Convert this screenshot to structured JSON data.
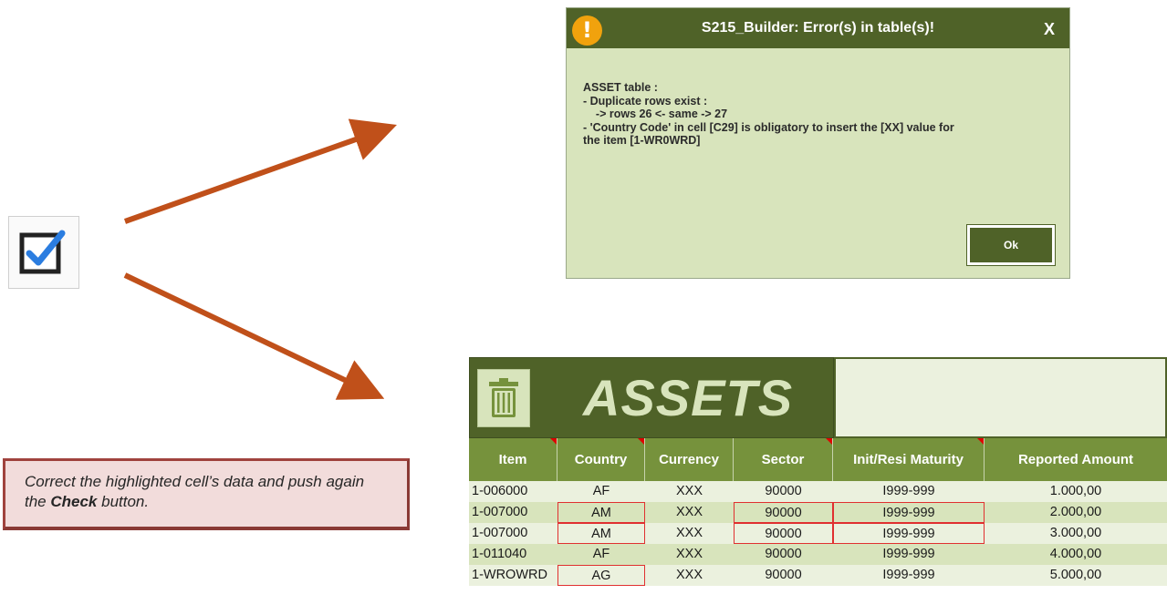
{
  "dialog": {
    "title": "S215_Builder: Error(s) in table(s)!",
    "close_label": "X",
    "warning_symbol": "!",
    "lines": [
      "ASSET table :",
      "- Duplicate rows exist :",
      "    -> rows 26 <- same -> 27",
      "- 'Country Code' in cell [C29] is obligatory to insert the [XX] value for",
      "the item [1-WR0WRD]"
    ],
    "ok_label": "Ok"
  },
  "note": {
    "text_before": "Correct the highlighted cell’s data and push again the ",
    "text_bold": "Check",
    "text_after": " button."
  },
  "sheet": {
    "title": "ASSETS",
    "columns": [
      "Item",
      "Country",
      "Currency",
      "Sector",
      "Init/Resi Maturity",
      "Reported Amount"
    ],
    "rows": [
      [
        "1-006000",
        "AF",
        "XXX",
        "90000",
        "I999-999",
        "1.000,00"
      ],
      [
        "1-007000",
        "AM",
        "XXX",
        "90000",
        "I999-999",
        "2.000,00"
      ],
      [
        "1-007000",
        "AM",
        "XXX",
        "90000",
        "I999-999",
        "3.000,00"
      ],
      [
        "1-011040",
        "AF",
        "XXX",
        "90000",
        "I999-999",
        "4.000,00"
      ],
      [
        "1-WROWRD",
        "AG",
        "XXX",
        "90000",
        "I999-999",
        "5.000,00"
      ]
    ]
  },
  "colors": {
    "dark_green": "#4f6228",
    "header_green": "#76923c",
    "light_green": "#d8e4bc",
    "pale_green": "#ebf1de",
    "highlight_red": "#e03030",
    "arrow": "#c0501a"
  }
}
